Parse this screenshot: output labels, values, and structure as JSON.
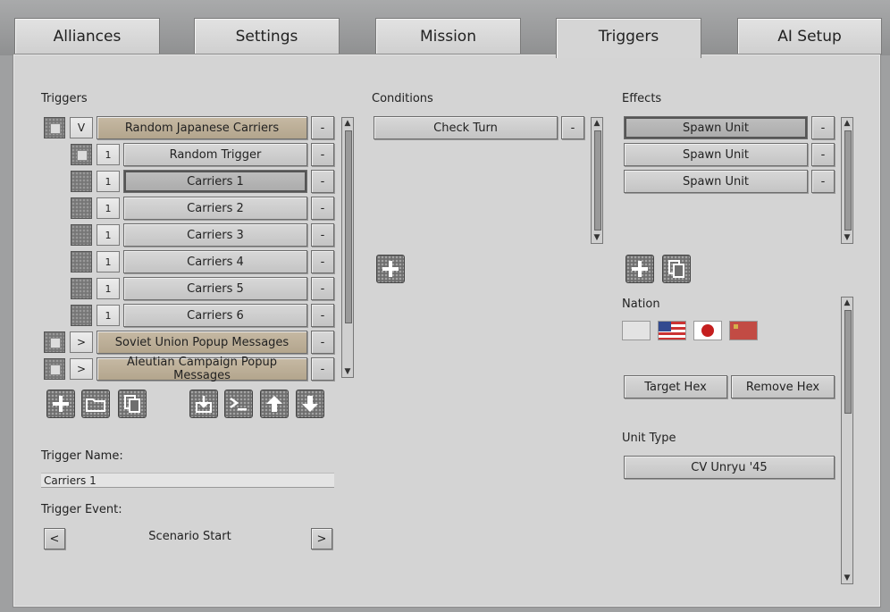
{
  "tabs": [
    {
      "label": "Alliances"
    },
    {
      "label": "Settings"
    },
    {
      "label": "Mission"
    },
    {
      "label": "Triggers"
    },
    {
      "label": "AI Setup"
    }
  ],
  "triggers": {
    "heading": "Triggers",
    "items": [
      {
        "toggle": "V",
        "label": "Random Japanese Carriers",
        "remove": "-"
      },
      {
        "num": "1",
        "label": "Random Trigger",
        "remove": "-"
      },
      {
        "num": "1",
        "label": "Carriers 1",
        "remove": "-"
      },
      {
        "num": "1",
        "label": "Carriers 2",
        "remove": "-"
      },
      {
        "num": "1",
        "label": "Carriers 3",
        "remove": "-"
      },
      {
        "num": "1",
        "label": "Carriers 4",
        "remove": "-"
      },
      {
        "num": "1",
        "label": "Carriers 5",
        "remove": "-"
      },
      {
        "num": "1",
        "label": "Carriers 6",
        "remove": "-"
      },
      {
        "toggle": ">",
        "label": "Soviet Union Popup Messages",
        "remove": "-"
      },
      {
        "toggle": ">",
        "label": "Aleutian Campaign Popup Messages",
        "remove": "-"
      }
    ],
    "name_label": "Trigger Name:",
    "name_value": "Carriers 1",
    "event_label": "Trigger Event:",
    "event_value": "Scenario Start",
    "prev": "<",
    "next": ">"
  },
  "conditions": {
    "heading": "Conditions",
    "items": [
      {
        "label": "Check Turn",
        "remove": "-"
      }
    ]
  },
  "effects": {
    "heading": "Effects",
    "items": [
      {
        "label": "Spawn Unit",
        "remove": "-"
      },
      {
        "label": "Spawn Unit",
        "remove": "-"
      },
      {
        "label": "Spawn Unit",
        "remove": "-"
      }
    ],
    "nation_label": "Nation",
    "target_hex": "Target Hex",
    "remove_hex": "Remove Hex",
    "unit_type_label": "Unit Type",
    "unit_type_value": "CV Unryu '45"
  },
  "icons": {
    "add": "+",
    "scroll_up": "▲",
    "scroll_down": "▼"
  }
}
